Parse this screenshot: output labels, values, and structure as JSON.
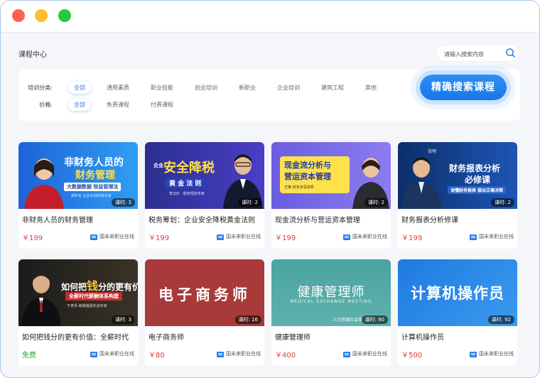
{
  "header": {
    "title": "课程中心"
  },
  "search": {
    "placeholder": "请输入搜索内容",
    "button_label": "精确搜索课程"
  },
  "filters": {
    "category": {
      "label": "培训分类:",
      "options": [
        "全部",
        "通用素质",
        "职业技能",
        "创业培训",
        "新职业",
        "企业培训",
        "建筑工程",
        "其他"
      ],
      "selected": "全部"
    },
    "price": {
      "label": "价格:",
      "options": [
        "全部",
        "免费课程",
        "付费课程"
      ],
      "selected": "全部"
    }
  },
  "courses": [
    {
      "title": "非财务人员的财务管理",
      "price": "￥199",
      "lessons": "课时: 3",
      "org": "国未来职业在线",
      "thumb": {
        "line1": "非财务人员的",
        "line2": "财务管理",
        "line3": "大数据数据 效益管理法",
        "teacher": "郝秒花  企业实战授课专家",
        "bg1": "#1e63d8",
        "bg2": "#2f9df4"
      }
    },
    {
      "title": "税务筹划：企业安全降税黄金法则",
      "price": "￥199",
      "lessons": "课时: 2",
      "org": "国未来职业在线",
      "thumb": {
        "line0": "企业",
        "line1": "安全降税",
        "line2": "黄 金 法 则",
        "teacher": "李汉红 · 税务规划专家",
        "bg1": "#2a2f8f",
        "bg2": "#4a3ec6"
      }
    },
    {
      "title": "现金流分析与营运资本管理",
      "price": "￥199",
      "lessons": "课时: 2",
      "org": "国未来职业在线",
      "thumb": {
        "line1": "现金流分析与",
        "line2": "营运资本管理",
        "teacher": "王琳  财务资深讲师",
        "bg1": "#6a5de0",
        "bg2": "#8d7cf0"
      }
    },
    {
      "title": "财务报表分析修课",
      "price": "￥199",
      "lessons": "课时: 2",
      "org": "国未来职业在线",
      "thumb": {
        "line1": "财务报表分析",
        "line2": "必修课",
        "line3": "读懂财务报表 做出正确决策",
        "teacher": "张明",
        "bg1": "#0b2f6a",
        "bg2": "#1e56b5"
      }
    },
    {
      "title": "如何把钱分的更有价值：全薪时代",
      "price": "免费",
      "lessons": "课时: 3",
      "org": "国未来职业在线",
      "free": true,
      "thumb": {
        "line1": "如何把",
        "line1b": "钱",
        "line1c": "分的更有价值",
        "line2": "全薪时代薪酬体系构建",
        "teacher": "于老师  薪酬激励实战专家",
        "bg1": "#1b1b1b",
        "bg2": "#3a3326"
      }
    },
    {
      "title": "电子商务师",
      "price": "￥80",
      "lessons": "课时: 16",
      "org": "国未来职业在线",
      "thumb": {
        "line1": "电子商务师",
        "bg1": "#a83a3a",
        "bg2": "#a83a3a"
      }
    },
    {
      "title": "健康管理师",
      "price": "￥400",
      "lessons": "课时: 90",
      "org": "国未来职业在线",
      "thumb": {
        "line1": "健康管理师",
        "line2": "MEDICAL EXCHANGE MEETING",
        "line3": "人力资源社会保",
        "bg1": "#4aa3a0",
        "bg2": "#5fb2ad"
      }
    },
    {
      "title": "计算机操作员",
      "price": "￥500",
      "lessons": "课时: 92",
      "org": "国未来职业在线",
      "thumb": {
        "line1": "计算机操作员",
        "bg1": "#1f7ae0",
        "bg2": "#3b9af0"
      }
    }
  ],
  "colors": {
    "accent": "#2a7ee8",
    "price": "#e23b3b",
    "free": "#20a82a"
  }
}
